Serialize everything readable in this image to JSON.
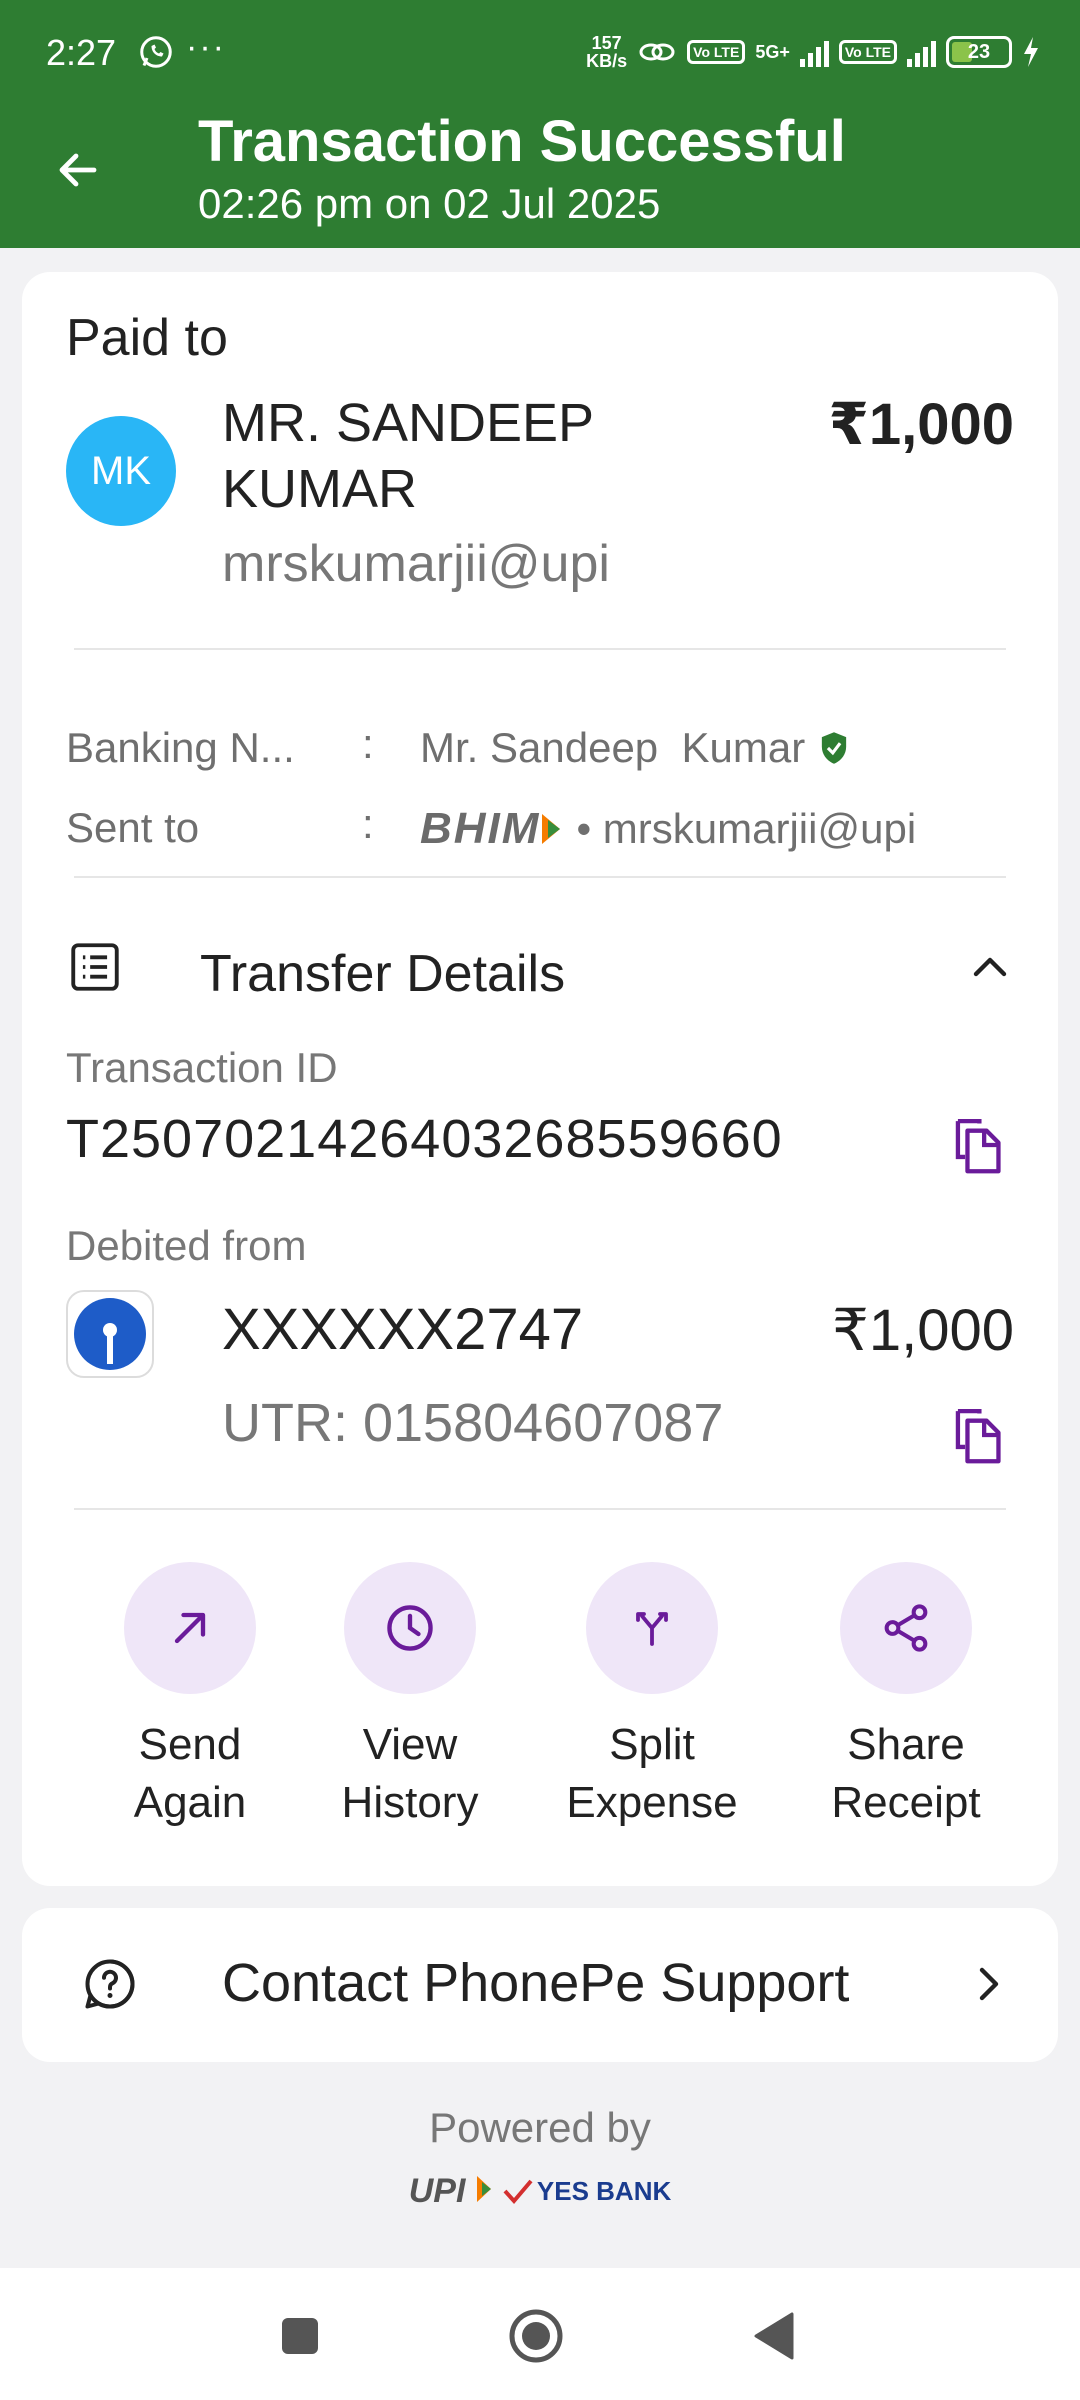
{
  "status_bar": {
    "time": "2:27",
    "dots": "···",
    "speed_value": "157",
    "speed_unit": "KB/s",
    "network": "5G+",
    "volte": "Vo LTE",
    "battery": "23"
  },
  "header": {
    "title": "Transaction Successful",
    "subtitle": "02:26 pm on 02 Jul 2025",
    "color": "#2e7d32"
  },
  "payment": {
    "paid_to_label": "Paid to",
    "avatar_initials": "MK",
    "payee_name": "MR. SANDEEP KUMAR",
    "payee_upi": "mrskumarjii@upi",
    "amount": "₹1,000"
  },
  "recipient_info": {
    "banking_name_label": "Banking N...",
    "banking_name_value": "Mr. Sandeep  Kumar",
    "sent_to_label": "Sent to",
    "sent_to_app": "BHIM",
    "sent_to_value": "• mrskumarjii@upi",
    "colon": ":"
  },
  "transfer_details": {
    "title": "Transfer Details",
    "transaction_id_label": "Transaction ID",
    "transaction_id": "T2507021426403268559660",
    "debited_from_label": "Debited from",
    "account": "XXXXXX2747",
    "amount": "₹1,000",
    "utr": "UTR: 015804607087"
  },
  "actions": [
    {
      "line1": "Send",
      "line2": "Again",
      "icon": "arrow-up-right-icon"
    },
    {
      "line1": "View",
      "line2": "History",
      "icon": "clock-icon"
    },
    {
      "line1": "Split",
      "line2": "Expense",
      "icon": "split-icon"
    },
    {
      "line1": "Share",
      "line2": "Receipt",
      "icon": "share-icon"
    }
  ],
  "support": {
    "label": "Contact PhonePe Support"
  },
  "footer": {
    "powered_by": "Powered by",
    "upi_logo": "UPI",
    "bank_logo": "YES BANK"
  },
  "colors": {
    "accent": "#6a1b9a",
    "action_bg": "#efe6f8",
    "avatar": "#29b6f6",
    "verified": "#2e7d32"
  }
}
